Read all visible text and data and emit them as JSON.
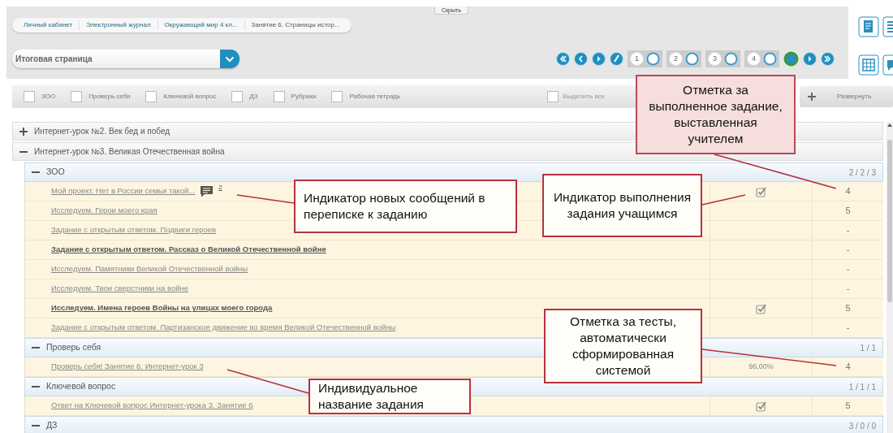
{
  "breadcrumbs": [
    {
      "label": "Личный кабинет",
      "current": false
    },
    {
      "label": "Электронный журнал",
      "current": false
    },
    {
      "label": "Окружающий мир 4 кл...",
      "current": false
    },
    {
      "label": "Занятие 6. Страницы истор...",
      "current": true
    }
  ],
  "hide_button": "Скрыть",
  "page_select": {
    "value": "Итоговая страница"
  },
  "pages": [
    {
      "label": "1"
    },
    {
      "label": "2"
    },
    {
      "label": "3"
    },
    {
      "label": "4"
    }
  ],
  "filters": [
    {
      "label": "ЗОО",
      "checked": false
    },
    {
      "label": "Проверь себя",
      "checked": false
    },
    {
      "label": "Ключевой вопрос",
      "checked": false
    },
    {
      "label": "ДЗ",
      "checked": false
    },
    {
      "label": "Рубрики",
      "checked": false
    },
    {
      "label": "Рабочая тетрадь",
      "checked": false
    }
  ],
  "select_all": {
    "label": "Выделить все",
    "checked": false
  },
  "expand_button": {
    "label": "Развернуть"
  },
  "lessons": [
    {
      "title": "Интернет-урок №2. Век бед и побед",
      "expanded": false
    },
    {
      "title": "Интернет-урок №3. Великая Отечественная война",
      "expanded": true,
      "sections": [
        {
          "title": "ЗОО",
          "count": "2 / 2 / 3",
          "expanded": true,
          "tasks": [
            {
              "title": "Мой проект. Нет в России семьи такой...",
              "bold": false,
              "messages": "2",
              "done": true,
              "mark": "4"
            },
            {
              "title": "Исследуем. Герои моего края",
              "bold": false,
              "done": false,
              "mark": "5"
            },
            {
              "title": "Задание с открытым ответом. Подвиги героев",
              "bold": false,
              "done": false,
              "mark": "-"
            },
            {
              "title": "Задание с открытым ответом. Рассказ о Великой Отечественной войне",
              "bold": true,
              "done": false,
              "mark": "-"
            },
            {
              "title": "Исследуем. Памятники Великой Отечественной войны",
              "bold": false,
              "done": false,
              "mark": "-"
            },
            {
              "title": "Исследуем. Твои сверстники на войне",
              "bold": false,
              "done": false,
              "mark": "-"
            },
            {
              "title": "Исследуем. Имена героев Войны на улицах моего города",
              "bold": true,
              "done": true,
              "mark": "5"
            },
            {
              "title": "Задание с открытым ответом. Партизанское движение во время Великой Отечественной войны",
              "bold": false,
              "done": false,
              "mark": "-"
            }
          ]
        },
        {
          "title": "Проверь себя",
          "count": "1 / 1",
          "expanded": true,
          "tasks": [
            {
              "title": "Проверь себя! Занятие 6. Интернет-урок 3",
              "bold": false,
              "done": false,
              "result": "96,00%",
              "mark": "4"
            }
          ]
        },
        {
          "title": "Ключевой вопрос",
          "count": "1 / 1 / 1",
          "expanded": true,
          "tasks": [
            {
              "title": "Ответ на Ключевой вопрос Интернет-урока 3. Занятие 6",
              "bold": false,
              "done": true,
              "mark": "5"
            }
          ]
        },
        {
          "title": "ДЗ",
          "count": "3 / 0 / 0",
          "expanded": true
        }
      ]
    }
  ],
  "callouts": [
    {
      "text": "Отметка за выполненное задание, выставленная учителем",
      "kind": "tinted"
    },
    {
      "text": "Индикатор новых сообщений в переписке к заданию",
      "kind": "plain"
    },
    {
      "text": "Индикатор выполнения задания учащимся",
      "kind": "plain"
    },
    {
      "text": "Индивидуальное название задания",
      "kind": "plain"
    },
    {
      "text": "Отметка за тесты, автоматически сформированная системой",
      "kind": "plain"
    }
  ]
}
